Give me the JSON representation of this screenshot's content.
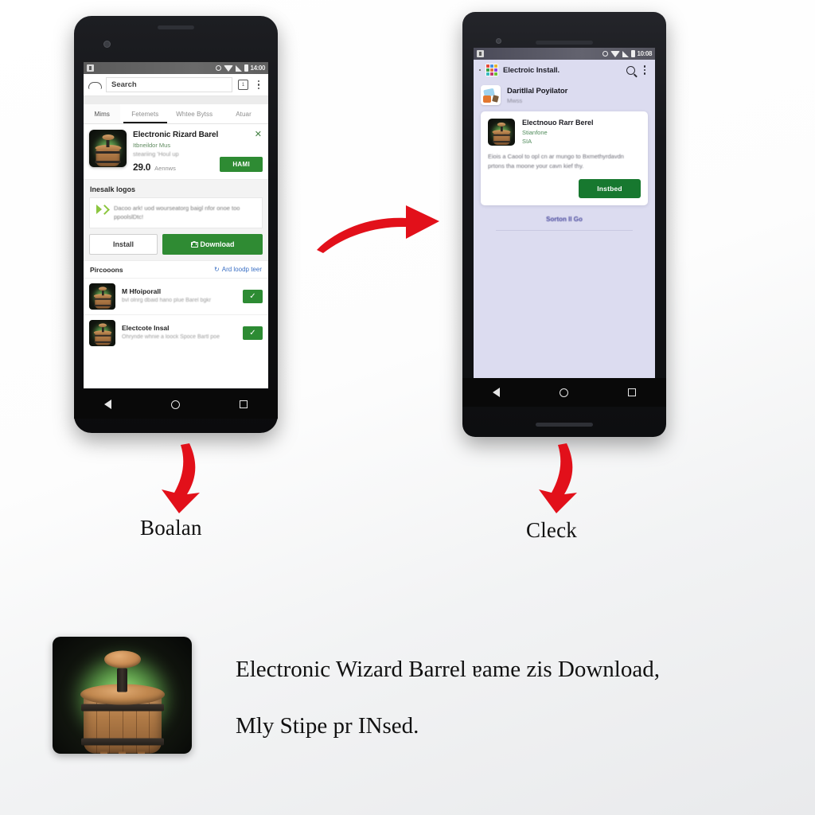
{
  "meta": {
    "arrow_color": "#e2101a",
    "accent_green": "#2e8b33",
    "deep_green": "#17782f"
  },
  "phone1": {
    "statusbar": {
      "time": "14:00",
      "left_icon": "sim-card-icon"
    },
    "searchbar": {
      "home_icon": "home-icon",
      "search_value": "Search",
      "badge_icon": "tab-count-icon",
      "badge_value": "1",
      "menu_icon": "overflow-menu-icon"
    },
    "tabs": [
      {
        "label": "Mims",
        "active": false
      },
      {
        "label": "Fetemets",
        "active": true
      },
      {
        "label": "Whtee Bytss",
        "active": false
      },
      {
        "label": "Atuar",
        "active": false
      }
    ],
    "featured_app": {
      "title": "Electronic Rizard Barel",
      "subtitle": "Itbneildor Mus",
      "subtitle2": "steariing 'Houl up",
      "rating": "29.0",
      "rating_label": "Aennws",
      "close_icon": "close-icon",
      "action_label": "HAMI",
      "app_icon": "barrel-app-icon"
    },
    "install_section": {
      "heading": "Inesalk logos",
      "notice_icon": "install-arrow-icon",
      "notice_text": "Dacoo ark! uod wourseatorg baigl nfor onoe too ppoolslDtc!",
      "install_button": "Install",
      "download_button": "Download",
      "download_icon": "lock-icon"
    },
    "recommend_section": {
      "heading": "Pircooons",
      "link_label": "Ard loodp teer",
      "link_icon": "refresh-icon",
      "items": [
        {
          "title": "M Hfoiporall",
          "subtitle": "bvl olnrg dbaid hano plue Barel bgkr",
          "check_icon": "check-icon",
          "app_icon": "barrel-app-icon"
        },
        {
          "title": "Electcote Insal",
          "subtitle": "Ohrynde whnie a loock Spoce Bartl poe",
          "check_icon": "check-icon",
          "app_icon": "barrel-app-icon"
        }
      ]
    },
    "navbar": {
      "back": "back-icon",
      "home": "home-circle-icon",
      "recents": "recents-icon"
    }
  },
  "phone2": {
    "statusbar": {
      "time": "10:08",
      "left_icon": "sim-card-icon"
    },
    "appbar": {
      "grid_icon": "apps-grid-icon",
      "title": "Electroic Install.",
      "search_icon": "search-icon",
      "menu_icon": "overflow-menu-icon"
    },
    "subheader": {
      "icon": "package-installer-icon",
      "title": "Daritllal Poyilator",
      "caption": "Mwss"
    },
    "card": {
      "app_icon": "barrel-app-icon",
      "title": "Electnouo Rarr Berel",
      "developer": "Stianfone",
      "version": "SIA",
      "body": "Eiois a Caool to opl cn ar mungo to Bxmethyrdavdn prtons tha moone your cavn kief thy.",
      "install_button": "Instbed"
    },
    "footer_link": "Sorton Il Go",
    "navbar": {
      "back": "back-icon",
      "home": "home-circle-icon",
      "recents": "recents-icon"
    }
  },
  "annotations": {
    "transition_arrow": "curved-right-arrow-icon",
    "step1_arrow": "curved-down-arrow-icon",
    "step1_label": "Boalan",
    "step2_arrow": "curved-down-arrow-icon",
    "step2_label": "Cleck"
  },
  "footer": {
    "hero_icon": "barrel-hero-icon",
    "caption_line1": "Electronic Wizard Barrel ɐame zis Download,",
    "caption_line2": "Mly Stipe pr INsed."
  }
}
